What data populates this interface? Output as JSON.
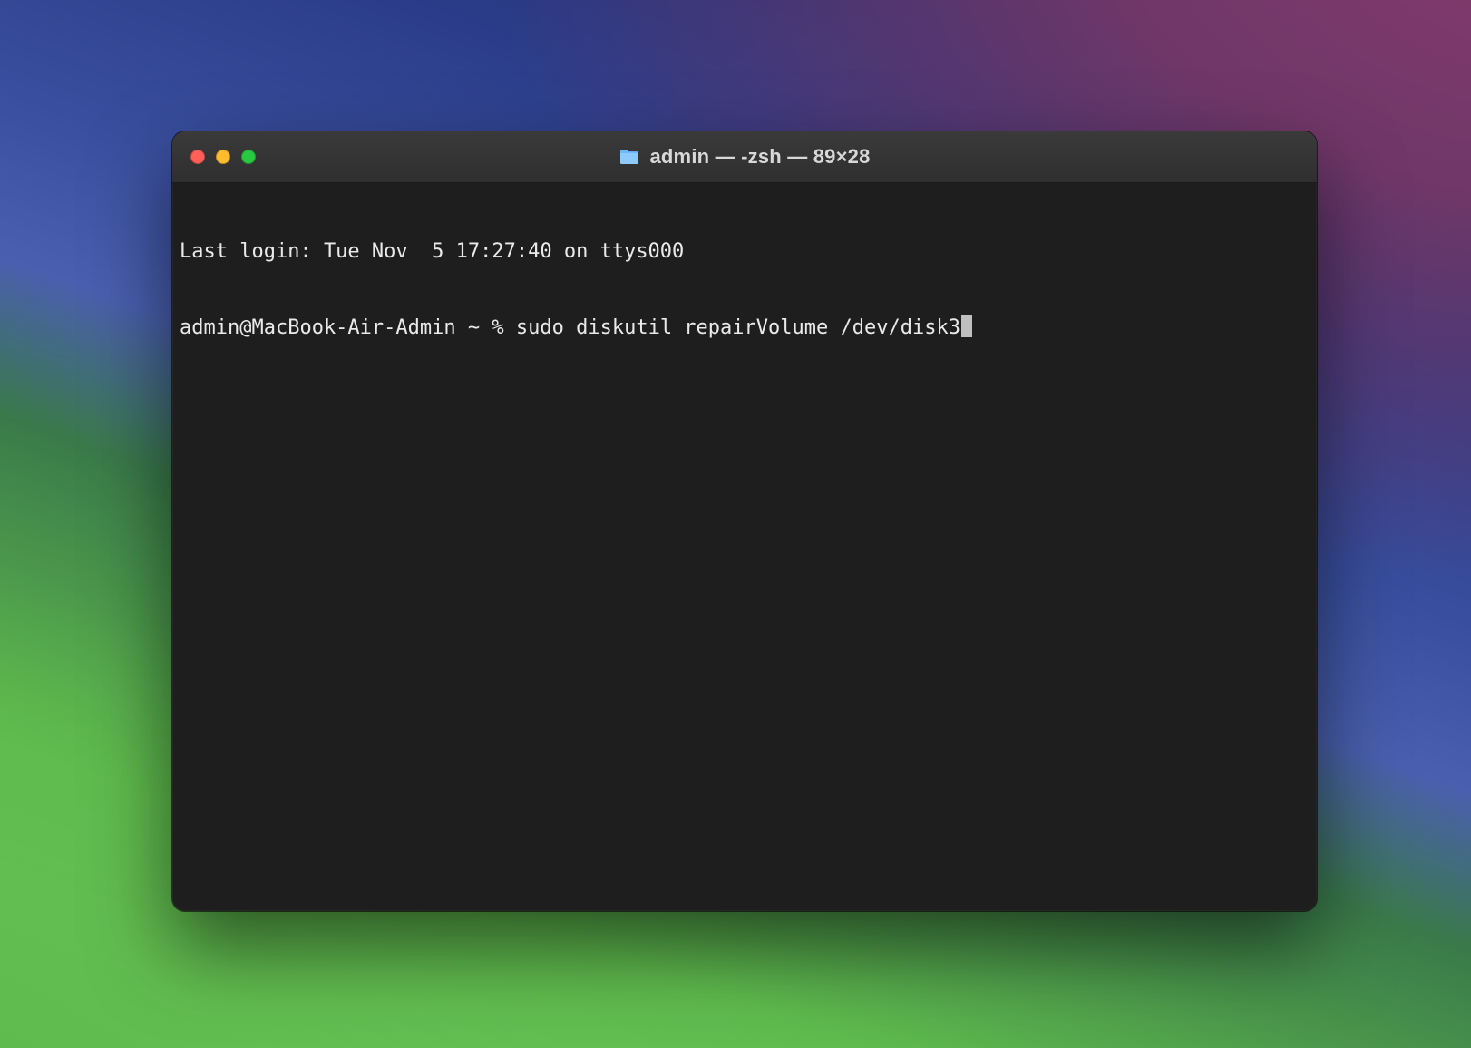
{
  "window": {
    "title": "admin — -zsh — 89×28",
    "icon": "folder-icon",
    "traffic_lights": {
      "close": "#ff5f57",
      "minimize": "#febc2e",
      "maximize": "#28c840"
    }
  },
  "terminal": {
    "last_login_line": "Last login: Tue Nov  5 17:27:40 on ttys000",
    "prompt": "admin@MacBook-Air-Admin ~ % ",
    "command": "sudo diskutil repairVolume /dev/disk3"
  }
}
